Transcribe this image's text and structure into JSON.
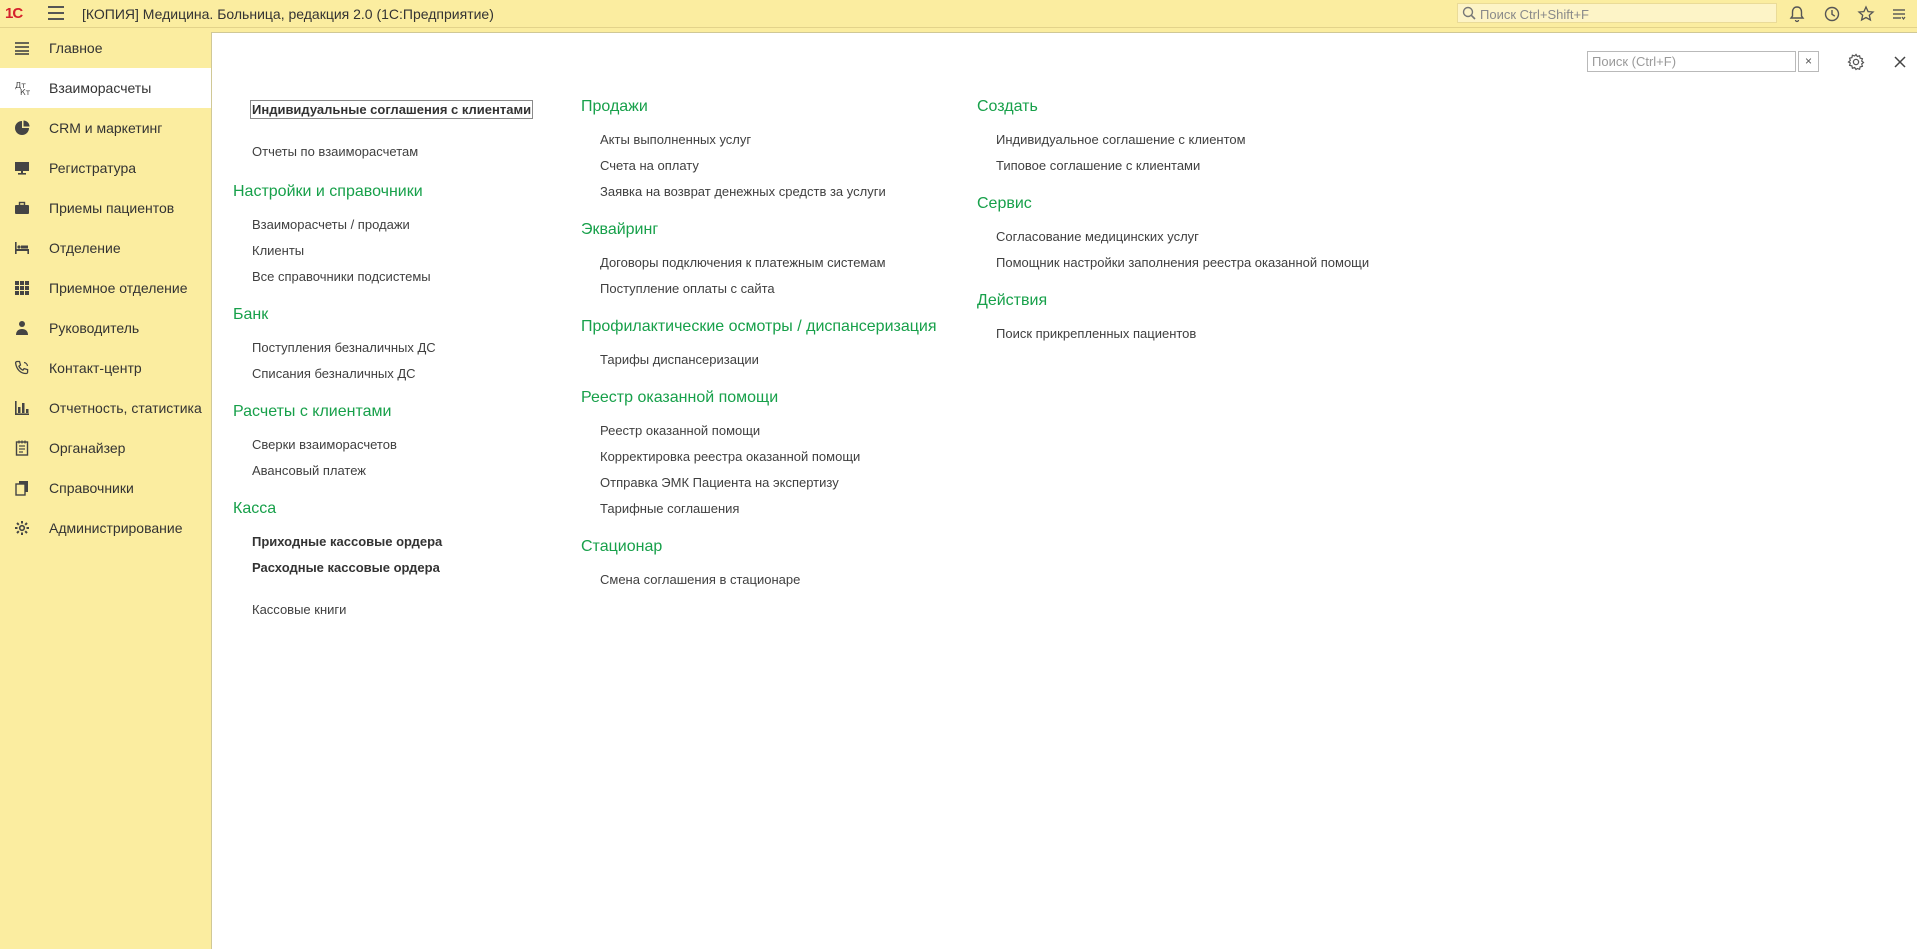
{
  "topbar": {
    "logo_text": "1С",
    "title": "[КОПИЯ] Медицина. Больница, редакция 2.0  (1С:Предприятие)",
    "search_placeholder": "Поиск Ctrl+Shift+F",
    "icons": [
      "bell-icon",
      "history-icon",
      "star-icon",
      "menu-lines-icon"
    ]
  },
  "sidebar": {
    "items": [
      {
        "label": "Главное",
        "icon": "list-icon"
      },
      {
        "label": "Взаиморасчеты",
        "icon": "settlements-icon",
        "active": true
      },
      {
        "label": "CRM и маркетинг",
        "icon": "pie-chart-icon"
      },
      {
        "label": "Регистратура",
        "icon": "monitor-icon"
      },
      {
        "label": "Приемы пациентов",
        "icon": "briefcase-icon"
      },
      {
        "label": "Отделение",
        "icon": "bed-icon"
      },
      {
        "label": "Приемное отделение",
        "icon": "grid-icon"
      },
      {
        "label": "Руководитель",
        "icon": "person-icon"
      },
      {
        "label": "Контакт-центр",
        "icon": "phone-icon"
      },
      {
        "label": "Отчетность, статистика",
        "icon": "bar-chart-icon"
      },
      {
        "label": "Органайзер",
        "icon": "notepad-icon"
      },
      {
        "label": "Справочники",
        "icon": "books-icon"
      },
      {
        "label": "Администрирование",
        "icon": "gear-icon"
      }
    ]
  },
  "content": {
    "search_placeholder": "Поиск (Ctrl+F)",
    "clear_label": "×",
    "col1": {
      "top_links": [
        "Индивидуальные соглашения с клиентами",
        "Отчеты по взаиморасчетам"
      ],
      "sections": [
        {
          "title": "Настройки и справочники",
          "links": [
            "Взаиморасчеты / продажи",
            "Клиенты",
            "Все справочники подсистемы"
          ]
        },
        {
          "title": "Банк",
          "links": [
            "Поступления безналичных ДС",
            "Списания безналичных ДС"
          ]
        },
        {
          "title": "Расчеты с клиентами",
          "links": [
            "Сверки взаиморасчетов",
            "Авансовый платеж"
          ]
        },
        {
          "title": "Касса",
          "links": [
            "Приходные кассовые ордера",
            "Расходные кассовые ордера",
            "Кассовые книги"
          ]
        }
      ]
    },
    "col2": {
      "sections": [
        {
          "title": "Продажи",
          "links": [
            "Акты выполненных услуг",
            "Счета на оплату",
            "Заявка на возврат денежных средств за услуги"
          ]
        },
        {
          "title": "Эквайринг",
          "links": [
            "Договоры подключения к платежным системам",
            "Поступление оплаты с сайта"
          ]
        },
        {
          "title": "Профилактические осмотры / диспансеризация",
          "links": [
            "Тарифы диспансеризации"
          ]
        },
        {
          "title": "Реестр оказанной помощи",
          "links": [
            "Реестр оказанной помощи",
            "Корректировка реестра оказанной помощи",
            "Отправка ЭМК Пациента на экспертизу",
            "Тарифные соглашения"
          ]
        },
        {
          "title": "Стационар",
          "links": [
            "Смена соглашения в стационаре"
          ]
        }
      ]
    },
    "col3": {
      "sections": [
        {
          "title": "Создать",
          "links": [
            "Индивидуальное соглашение с клиентом",
            "Типовое соглашение с клиентами"
          ]
        },
        {
          "title": "Сервис",
          "links": [
            "Согласование медицинских услуг",
            "Помощник настройки заполнения реестра оказанной помощи"
          ]
        },
        {
          "title": "Действия",
          "links": [
            "Поиск прикрепленных пациентов"
          ]
        }
      ]
    }
  }
}
